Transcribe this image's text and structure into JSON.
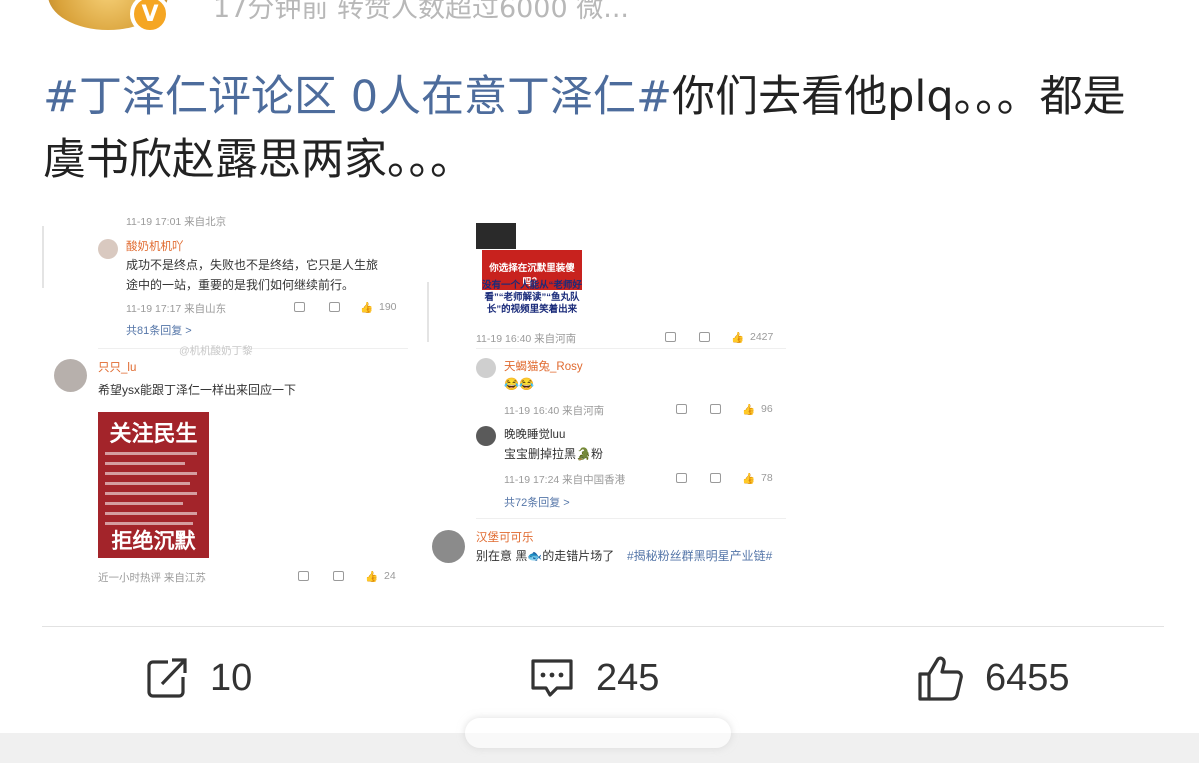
{
  "header": {
    "meta_text": "17分钟前 转赞人数超过6000 微..."
  },
  "post": {
    "tag": "#丁泽仁评论区 0人在意丁泽仁#",
    "body": "你们去看他plq。。。都是虞书欣赵露思两家。。。"
  },
  "image": {
    "left_col": {
      "top_meta": "11-19 17:01 来自北京",
      "comment1": {
        "user": "酸奶机机吖",
        "text_line1": "成功不是终点，失败也不是终结，它只是人生旅",
        "text_line2": "途中的一站，重要的是我们如何继续前行。",
        "meta": "11-19 17:17 来自山东",
        "likes": "190",
        "replies": "共81条回复 >"
      },
      "watermark": "@机机酸奶丁黎",
      "comment2": {
        "user": "只只_lu",
        "text": "希望ysx能跟丁泽仁一样出来回应一下",
        "poster_title": "关注民生",
        "poster_footer": "拒绝沉默",
        "meta": "近一小时热评  来自江苏",
        "likes": "24"
      }
    },
    "right_col": {
      "red_card_text": "你选择在沉默里装傻吗？",
      "blue_caption": "没有一个人能从“老师好看”“老师解读”“鱼丸队长”的视频里笑着出来",
      "meta1": "11-19 16:40 来自河南",
      "likes1": "2427",
      "reply1": {
        "user": "天蝎猫兔_Rosy",
        "text": "😂😂",
        "meta": "11-19 16:40 来自河南",
        "likes": "96"
      },
      "reply2": {
        "user": "晚晚睡觉luu",
        "text": "宝宝删掉拉黑🐊粉",
        "meta": "11-19 17:24 来自中国香港",
        "likes": "78"
      },
      "replies": "共72条回复 >",
      "comment3": {
        "user": "汉堡可可乐",
        "text": "别在意 黑🐟的走错片场了",
        "link": "#揭秘粉丝群黑明星产业链#"
      }
    }
  },
  "actions": {
    "repost_count": "10",
    "comment_count": "245",
    "like_count": "6455"
  },
  "colors": {
    "tag": "#4d6c9c",
    "username": "#e06a2f",
    "poster_red": "#a3242a"
  },
  "icons": [
    "repost-icon",
    "comment-icon",
    "like-icon",
    "verified-badge-icon"
  ]
}
